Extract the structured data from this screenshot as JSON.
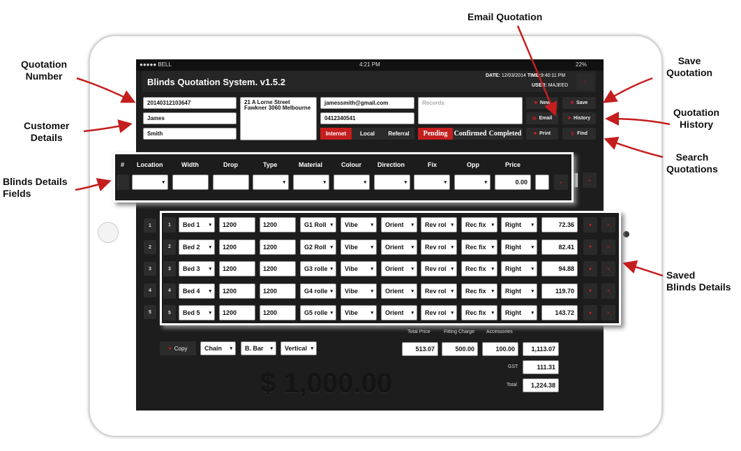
{
  "status_bar": {
    "carrier": "●●●●● BELL",
    "time": "4:21 PM",
    "battery": "22%"
  },
  "header": {
    "title": "Blinds Quotation System. v1.5.2",
    "date_label": "DATE:",
    "date": "12/03/2014",
    "time_label": "TIME:",
    "time": "9:40:11 PM",
    "user_label": "USER:",
    "user": "MAJEED"
  },
  "customer": {
    "quotation_number": "20140312103647",
    "first_name": "James",
    "last_name": "Smith",
    "address": "21 A Lorne Street\nFawkner 3060 Melbourne",
    "email": "jamessmith@gmail.com",
    "phone": "0412340541",
    "records_placeholder": "Records"
  },
  "source_tabs": [
    "Internet",
    "Local",
    "Referral"
  ],
  "status_tabs": [
    "Pending",
    "Confirmed",
    "Completed"
  ],
  "actions": {
    "new": "New",
    "save": "Save",
    "email": "Email",
    "history": "History",
    "print": "Print",
    "find": "Find"
  },
  "columns": [
    "#",
    "Location",
    "Width",
    "Drop",
    "Type",
    "Material",
    "Colour",
    "Direction",
    "Fix",
    "Opp",
    "Price"
  ],
  "new_row": {
    "price": "0.00"
  },
  "rows": [
    {
      "n": "1",
      "location": "Bed 1",
      "width": "1200",
      "drop": "1200",
      "type": "G1 Roll",
      "material": "Vibe",
      "colour": "Orient",
      "direction": "Rev rol",
      "fix": "Rec fix",
      "opp": "Right",
      "price": "72.36"
    },
    {
      "n": "2",
      "location": "Bed 2",
      "width": "1200",
      "drop": "1200",
      "type": "G2 Roll",
      "material": "Vibe",
      "colour": "Orient",
      "direction": "Rev rol",
      "fix": "Rec fix",
      "opp": "Right",
      "price": "82.41"
    },
    {
      "n": "3",
      "location": "Bed 3",
      "width": "1200",
      "drop": "1200",
      "type": "G3 rolle",
      "material": "Vibe",
      "colour": "Orient",
      "direction": "Rev rol",
      "fix": "Rec fix",
      "opp": "Right",
      "price": "94.88"
    },
    {
      "n": "4",
      "location": "Bed 4",
      "width": "1200",
      "drop": "1200",
      "type": "G4 rolle",
      "material": "Vibe",
      "colour": "Orient",
      "direction": "Rev rol",
      "fix": "Rec fix",
      "opp": "Right",
      "price": "119.70"
    },
    {
      "n": "5",
      "location": "Bed 5",
      "width": "1200",
      "drop": "1200",
      "type": "G5 rolle",
      "material": "Vibe",
      "colour": "Orient",
      "direction": "Rev rol",
      "fix": "Rec fix",
      "opp": "Right",
      "price": "143.72"
    }
  ],
  "footer": {
    "copy": "Copy",
    "control": "Chain",
    "bar": "B. Bar",
    "orientation": "Vertical",
    "total_price_label": "Total Price",
    "fitting_label": "Fitting Charge",
    "accessories_label": "Accessories",
    "total_price": "513.07",
    "fitting": "500.00",
    "accessories": "100.00",
    "subtotal": "1,113.07",
    "gst_label": "GST",
    "gst": "111.31",
    "total_label": "Total",
    "total": "1,224.38",
    "big_amount": "$ 1,000.00"
  },
  "annotations": {
    "quotation_number": "Quotation\nNumber",
    "customer_details": "Customer\nDetails",
    "blinds_fields": "Blinds Details\nFields",
    "email": "Email Quotation",
    "save": "Save\nQuotation",
    "history": "Quotation\nHistory",
    "search": "Search\nQuotations",
    "saved": "Saved\nBlinds Details"
  },
  "colors": {
    "accent": "#c41e1e",
    "background": "#1d1d1d"
  }
}
